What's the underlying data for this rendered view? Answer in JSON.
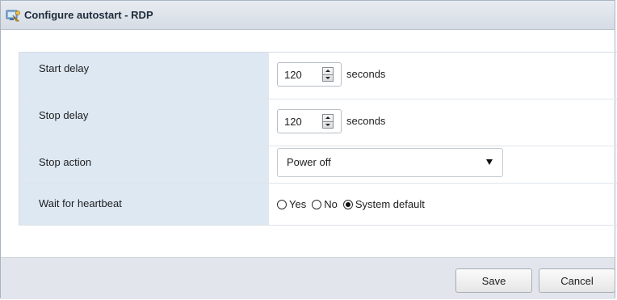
{
  "dialog": {
    "title": "Configure autostart - RDP",
    "icon": "vm-autostart-icon"
  },
  "form": {
    "start_delay": {
      "label": "Start delay",
      "value": "120",
      "unit": "seconds"
    },
    "stop_delay": {
      "label": "Stop delay",
      "value": "120",
      "unit": "seconds"
    },
    "stop_action": {
      "label": "Stop action",
      "selected": "Power off"
    },
    "wait_for_heartbeat": {
      "label": "Wait for heartbeat",
      "options": [
        {
          "label": "Yes",
          "checked": false
        },
        {
          "label": "No",
          "checked": false
        },
        {
          "label": "System default",
          "checked": true
        }
      ]
    }
  },
  "footer": {
    "save_label": "Save",
    "cancel_label": "Cancel"
  },
  "colors": {
    "label_bg": "#dde8f3",
    "titlebar_bg": "#dfe4ea",
    "footer_bg": "#e2e6ec"
  }
}
